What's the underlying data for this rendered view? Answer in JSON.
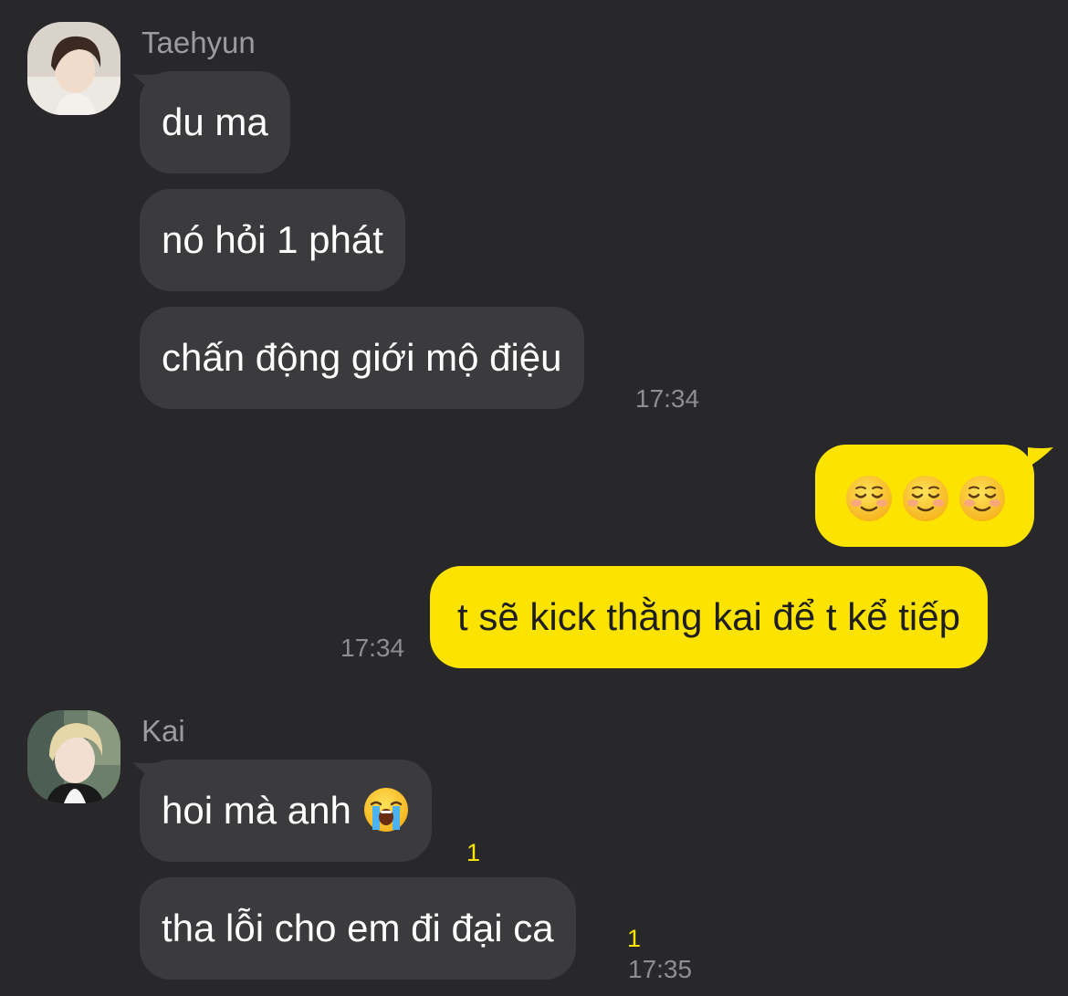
{
  "chat": {
    "groups": [
      {
        "sender": "Taehyun",
        "messages": [
          "du ma",
          "nó hỏi 1 phát",
          "chấn động giới mộ điệu"
        ],
        "time": "17:34"
      },
      {
        "sender": "Kai",
        "messages": [
          "hoi mà anh",
          "tha lỗi cho em đi đại ca"
        ],
        "unread": [
          "1",
          "1"
        ],
        "time": "17:35"
      }
    ],
    "outgoing": {
      "emoji_message": [
        "smiling-face-icon",
        "smiling-face-icon",
        "smiling-face-icon"
      ],
      "messages": [
        "t sẽ kick thằng kai để t kể tiếp"
      ],
      "time": "17:34"
    },
    "emoji": {
      "crying": "loudly-crying-face-icon"
    },
    "colors": {
      "background": "#28282a",
      "incoming_bubble": "#3b3b3d",
      "outgoing_bubble": "#fde300",
      "unread_count": "#fde300",
      "timestamp": "#8e8e92"
    }
  }
}
